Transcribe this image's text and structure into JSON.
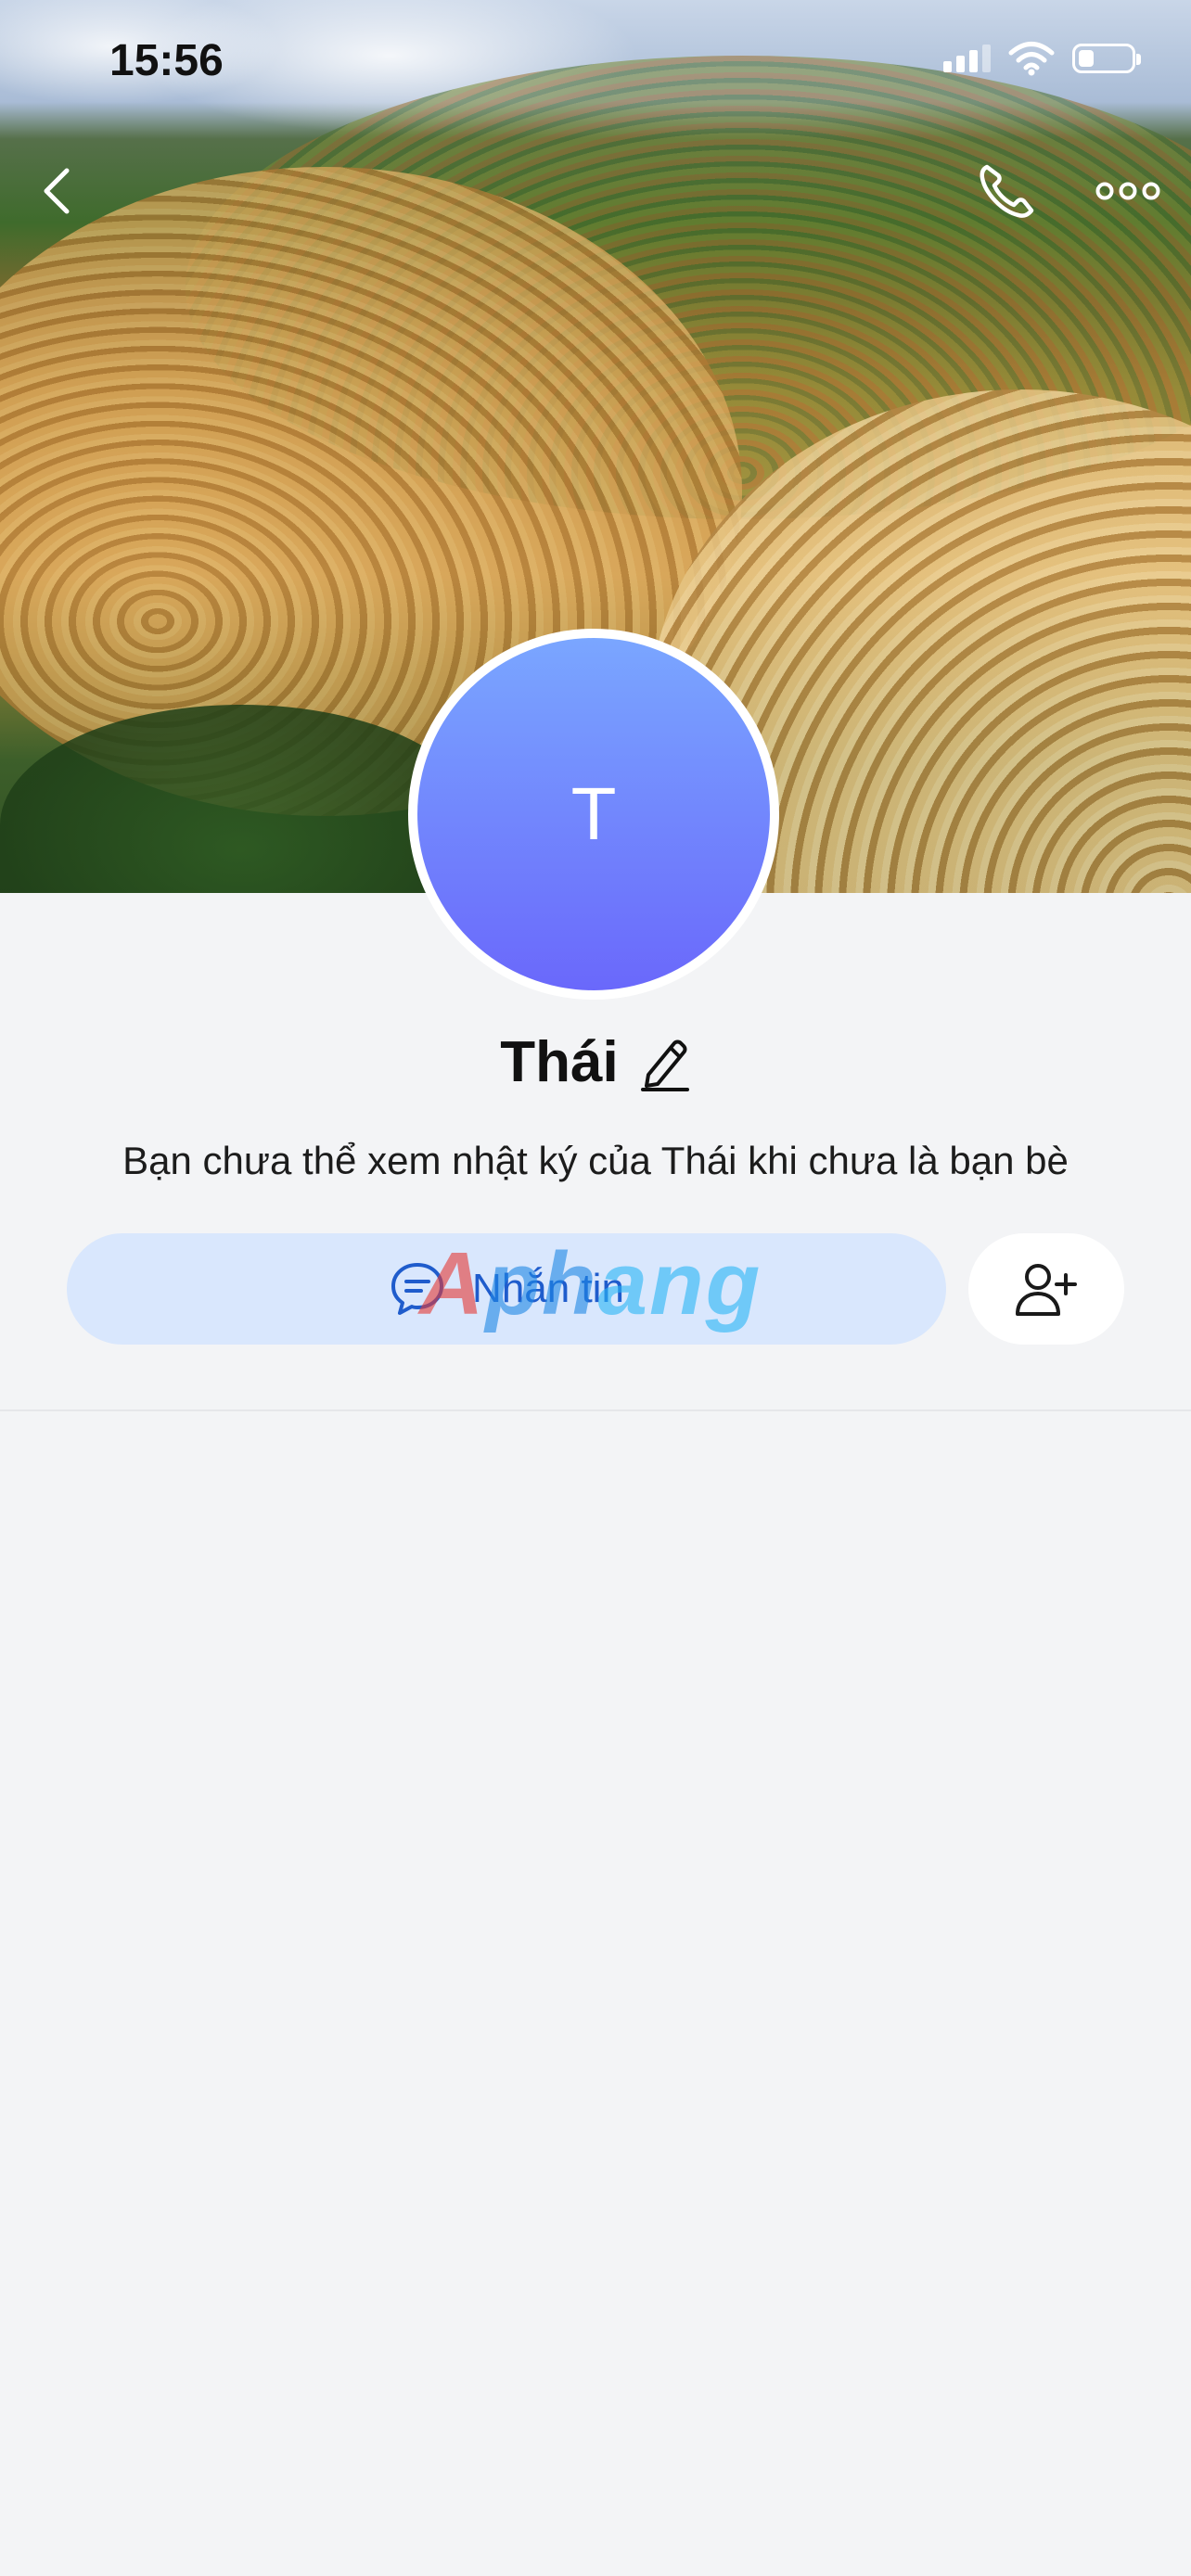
{
  "status_bar": {
    "time": "15:56",
    "signal_icon": "cellular-signal-icon",
    "wifi_icon": "wifi-icon",
    "battery_icon": "battery-icon",
    "battery_level": 0.3
  },
  "nav": {
    "back_icon": "chevron-left-icon",
    "call_icon": "phone-icon",
    "more_icon": "more-horizontal-icon"
  },
  "profile": {
    "avatar_initial": "T",
    "name": "Thái",
    "edit_icon": "pencil-icon",
    "diary_notice": "Bạn chưa thể xem nhật ký của Thái khi chưa là bạn bè"
  },
  "actions": {
    "message_label": "Nhắn tin",
    "message_icon": "chat-bubble-icon",
    "add_friend_icon": "add-user-icon"
  },
  "watermark": {
    "part1": "A",
    "part2": "ph",
    "part3": "ang"
  },
  "colors": {
    "background": "#f3f4f6",
    "avatar_gradient_top": "#7aa6ff",
    "avatar_gradient_bottom": "#6a68fb",
    "message_button_bg": "#d9e7fd",
    "message_text": "#1f5ccc"
  }
}
